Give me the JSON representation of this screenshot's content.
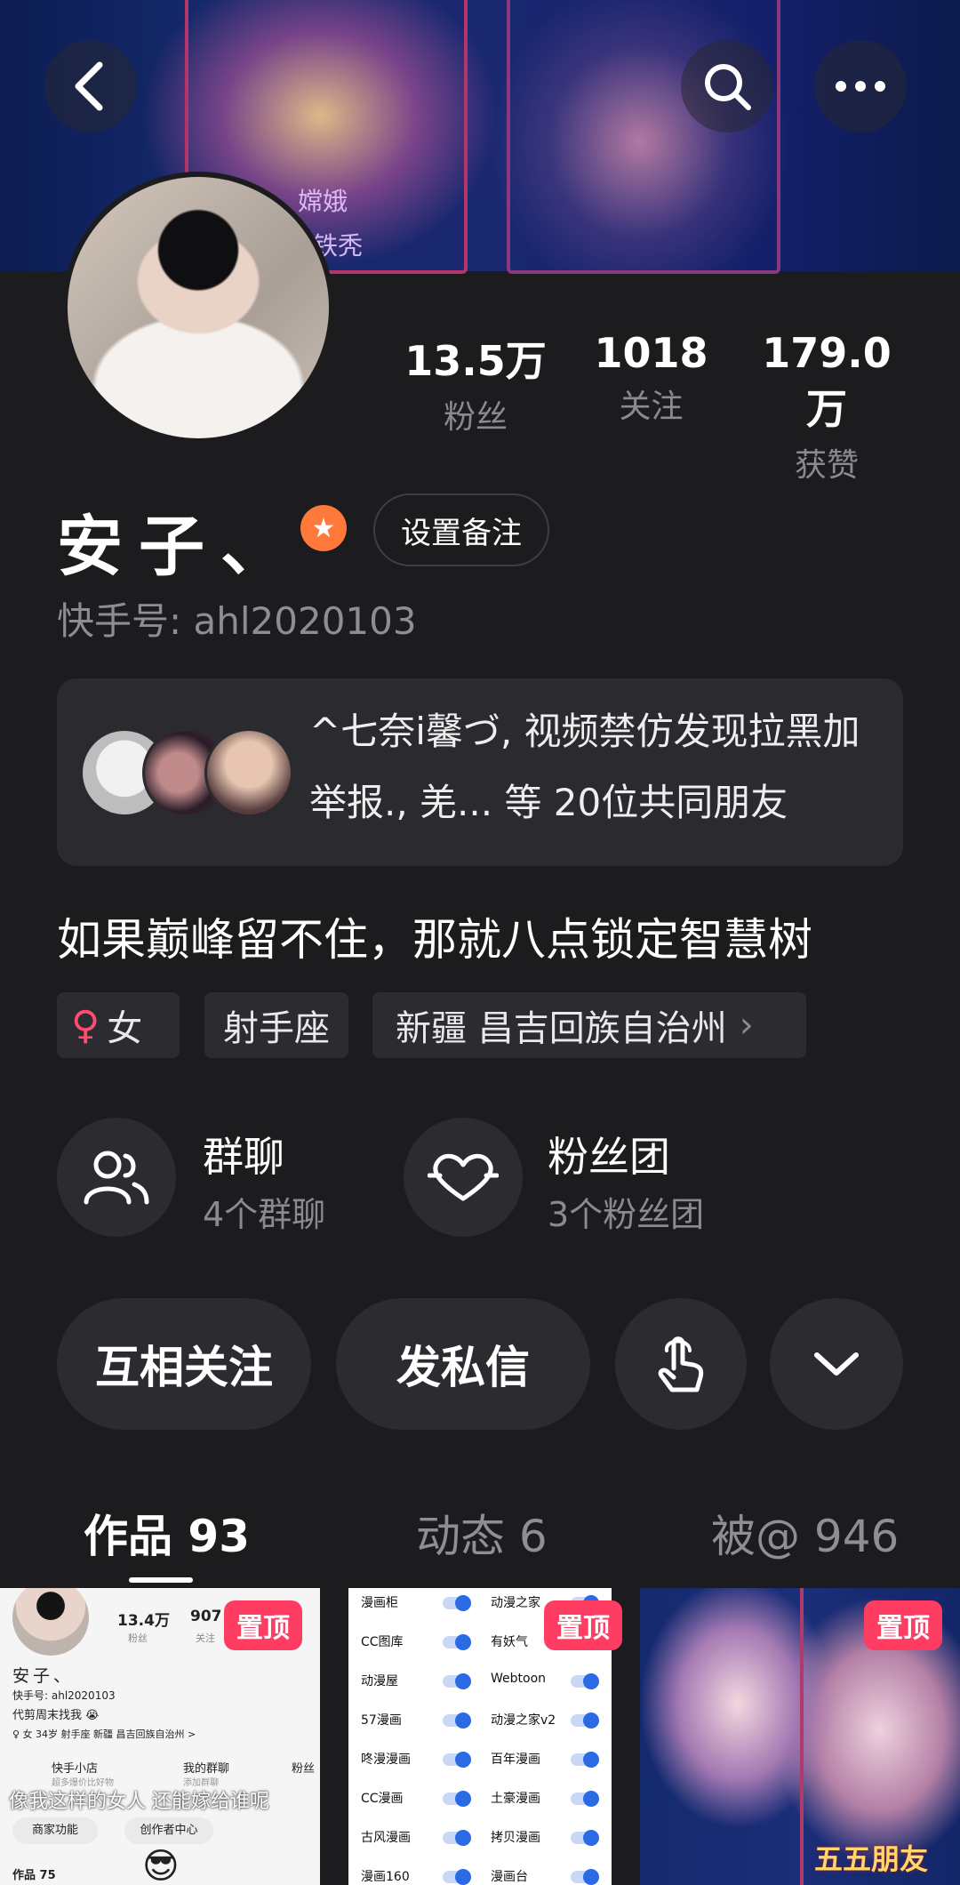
{
  "banner": {
    "text_1": "嫦娥",
    "text_2": "铁秃"
  },
  "stats": [
    {
      "value": "13.5万",
      "label": "粉丝"
    },
    {
      "value": "1018",
      "label": "关注"
    },
    {
      "value": "179.0万",
      "label": "获赞"
    }
  ],
  "profile": {
    "name": "安子、",
    "remark_label": "设置备注",
    "kuaishou_id": "快手号: ahl2020103"
  },
  "mutual": {
    "text": "^七奈i馨づ, 视频禁仿发现拉黑加举报., 羌... 等 20位共同朋友"
  },
  "bio": "如果巅峰留不住，那就八点锁定智慧树",
  "tags": {
    "gender": "女",
    "zodiac": "射手座",
    "location": "新疆 昌吉回族自治州"
  },
  "groups": [
    {
      "title": "群聊",
      "sub": "4个群聊"
    },
    {
      "title": "粉丝团",
      "sub": "3个粉丝团"
    }
  ],
  "actions": {
    "mutual_follow": "互相关注",
    "message": "发私信"
  },
  "tabs": [
    {
      "label": "作品 93"
    },
    {
      "label": "动态 6"
    },
    {
      "label": "被@ 946"
    }
  ],
  "thumbs": {
    "pin_label": "置顶",
    "t1": {
      "fans": "13.4万",
      "fans_label": "粉丝",
      "follow": "907",
      "follow_label": "关注",
      "name": "安子、",
      "id": "快手号: ahl2020103",
      "bio": "代剪周末找我 😭",
      "tags": "♀ 女   34岁   射手座   新疆 昌吉回族自治州 >",
      "shop": "快手小店",
      "shop_sub": "超多爆价比好物",
      "group": "我的群聊",
      "group_sub": "添加群聊",
      "fan": "粉丝",
      "overlay": "像我这样的女人 还能嫁给谁呢",
      "btn1": "商家功能",
      "btn2": "创作者中心",
      "works": "作品 75"
    },
    "t2": {
      "left": [
        "漫画柜",
        "CC图库",
        "动漫屋",
        "57漫画",
        "咚漫漫画",
        "CC漫画",
        "古风漫画",
        "漫画160"
      ],
      "right": [
        "动漫之家",
        "有妖气",
        "Webtoon",
        "动漫之家v2",
        "百年漫画",
        "土豪漫画",
        "拷贝漫画",
        "漫画台"
      ]
    },
    "t3": {
      "caption": "五五朋友"
    }
  },
  "colors": {
    "background": "#1c1c1f",
    "pin": "#ff3d63",
    "star_badge": "#ff7a3a",
    "female": "#ff4d6d"
  }
}
